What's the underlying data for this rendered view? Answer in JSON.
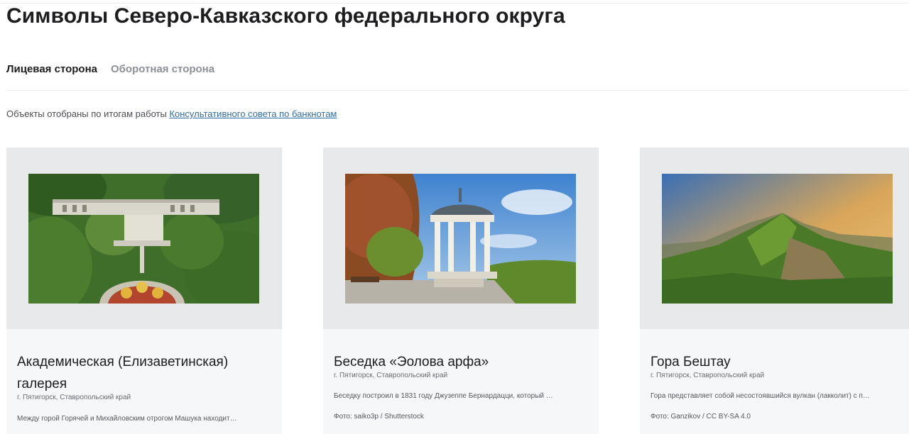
{
  "page": {
    "title": "Символы Северо-Кавказского федерального округа"
  },
  "tabs": [
    {
      "label": "Лицевая сторона",
      "active": true
    },
    {
      "label": "Оборотная сторона",
      "active": false
    }
  ],
  "note": {
    "text": "Объекты отобраны по итогам работы ",
    "link": "Консультативного совета по банкнотам"
  },
  "cards": [
    {
      "title": "Академическая (Елизаветинская) галерея",
      "location": "г. Пятигорск, Ставропольский край",
      "description": "Между горой Горячей и Михайловским отрогом Машука находит…",
      "image": "academic-gallery-photo"
    },
    {
      "title": "Беседка «Эолова арфа»",
      "location": "г. Пятигорск, Ставропольский край",
      "description": "Беседку построил в 1831 году Джузеппе Бернардацци, который …",
      "photo_credit": "Фото: saiko3p / Shutterstock",
      "image": "aeolian-harp-gazebo-photo"
    },
    {
      "title": "Гора Бештау",
      "location": "г. Пятигорск, Ставропольский край",
      "description": "Гора представляет собой несостоявшийся вулкан (лакколит) с п…",
      "photo_credit": "Фото: Ganzikov / CC BY-SA 4.0",
      "image": "beshtau-mountain-photo"
    }
  ],
  "colors": {
    "link": "#2f6fa7",
    "tab_inactive": "#8c9097",
    "card_media_bg": "#e8e9eb",
    "card_bg": "#f6f7f8"
  }
}
